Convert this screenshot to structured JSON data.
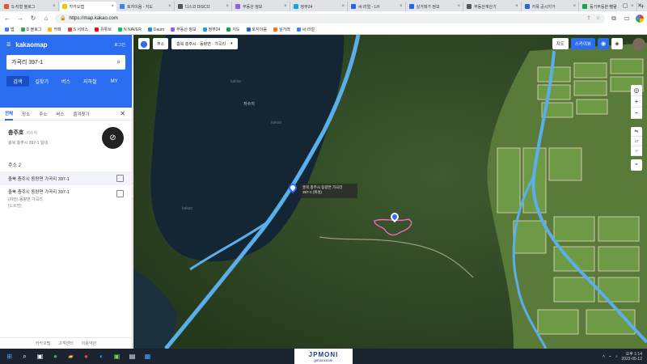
{
  "browser": {
    "tabs": [
      {
        "label": "S‑지형 블로그",
        "color": "#e4572e"
      },
      {
        "label": "카카오맵",
        "color": "#f7c600",
        "active": true
      },
      {
        "label": "토지이음 - 지도",
        "color": "#3b82f6"
      },
      {
        "label": "디스코 DISCO",
        "color": "#555555"
      },
      {
        "label": "부동산 정보",
        "color": "#8b5cf6"
      },
      {
        "label": "정부24",
        "color": "#0ea5e9"
      },
      {
        "label": "씨:리얼 - LH",
        "color": "#2563eb"
      },
      {
        "label": "실거래가 정보",
        "color": "#2563eb"
      },
      {
        "label": "부동산계산기",
        "color": "#555555"
      },
      {
        "label": "지목 공시지가",
        "color": "#2563eb"
      },
      {
        "label": "등기부등본 열람",
        "color": "#16a34a"
      }
    ],
    "url": "https://map.kakao.com",
    "bookmarks": [
      "앱",
      "D 블로그",
      "카페",
      "S 서비스",
      "유튜브",
      "N NAVER",
      "Daum",
      "부동산 정보",
      "정부24",
      "지도",
      "토지이음",
      "실거래",
      "씨:리얼"
    ]
  },
  "sidebar": {
    "logo": "kakaomap",
    "login": "로그인",
    "search_value": "가곡리 397-1",
    "categories": [
      "검색",
      "길찾기",
      "버스",
      "지하철",
      "MY"
    ],
    "subtabs": [
      "전체",
      "장소",
      "주소",
      "버스",
      "즐겨찾기"
    ],
    "place_name": "충주호",
    "place_tag": "저수지",
    "place_addr": "충북 충주시 397-1 일대",
    "section_title": "주소 2",
    "result1": "충북 충주시 동량면 가곡리 397-1",
    "result2_l1": "충북 충주시 동량면 가곡리 397-1",
    "result2_l2": "(지번) 동량면 가곡리",
    "result2_l3": "[도로명]",
    "footer": [
      "카카오맵",
      "고객센터",
      "이용약관"
    ]
  },
  "map": {
    "addr_chip": "충북 충주시 · 동량면 · 가곡리",
    "toolbar_btn": "주소",
    "map_types": [
      "지도",
      "스카이뷰"
    ],
    "reservoir_label": "저수지",
    "infobox_l1": "충북 충주시 동량면 가곡리",
    "infobox_l2": "397-1 (위성)",
    "watermark": "kakao"
  },
  "taskbar": {
    "brand": "JPMONI",
    "site": "jpmoni.com",
    "time": "오후 1:14",
    "date": "2022-05-12"
  }
}
